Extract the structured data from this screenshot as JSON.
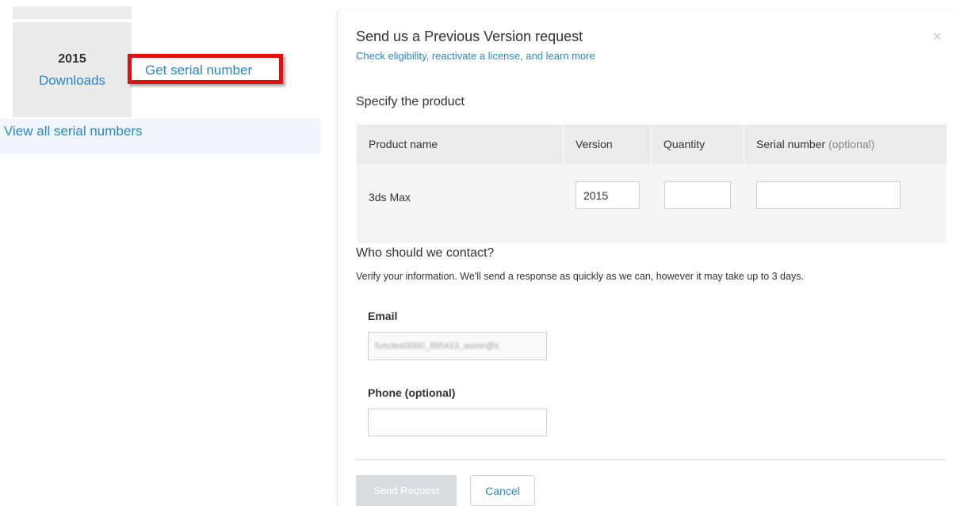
{
  "left": {
    "tile": {
      "year": "2015",
      "downloads_label": "Downloads"
    },
    "get_serial_label": "Get serial number",
    "view_all_label": "View all serial numbers"
  },
  "modal": {
    "title": "Send us a Previous Version request",
    "subtitle_link": "Check eligibility, reactivate a license, and learn more",
    "close_glyph": "×",
    "specify_heading": "Specify the product",
    "table": {
      "headers": {
        "product_name": "Product name",
        "version": "Version",
        "quantity": "Quantity",
        "serial": "Serial number",
        "serial_optional": "(optional)"
      },
      "row": {
        "product_name": "3ds Max",
        "version": "2015",
        "quantity": "",
        "serial": ""
      }
    },
    "contact_heading": "Who should we contact?",
    "contact_sub": "Verify your information. We'll send a response as quickly as we can, however it may take up to 3 days.",
    "email_label": "Email",
    "email_value": "functest3000_895413_auzer@s",
    "phone_label": "Phone (optional)",
    "phone_value": "",
    "send_label": "Send Request",
    "cancel_label": "Cancel"
  },
  "colors": {
    "link": "#2a88c8",
    "highlight_border": "#e01010",
    "disabled_button": "#d9dde1"
  },
  "icons": {
    "close": "close-icon"
  }
}
